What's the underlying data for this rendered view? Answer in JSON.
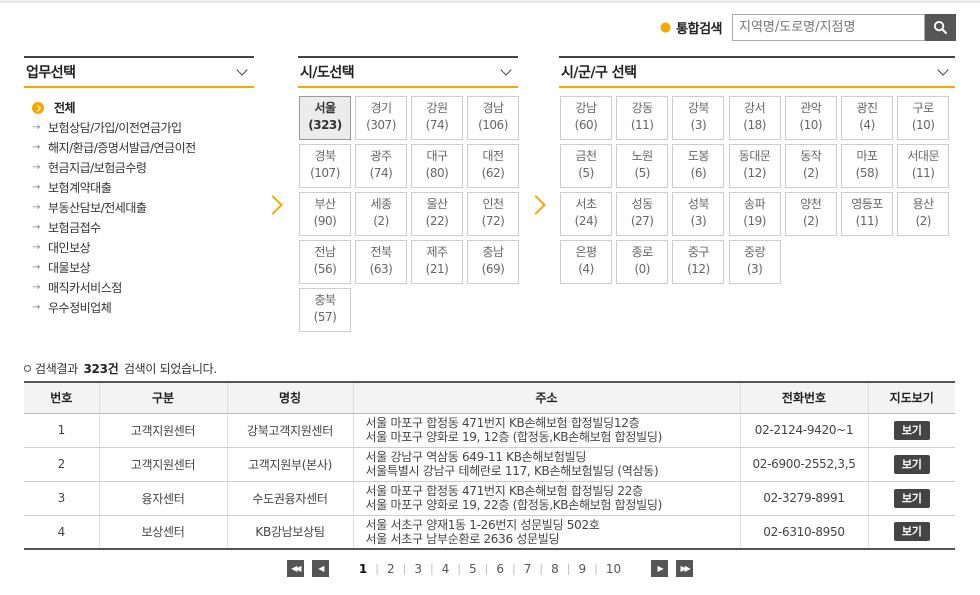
{
  "search": {
    "label": "통합검색",
    "placeholder": "지역명/도로명/지점명"
  },
  "panels": {
    "business": "업무선택",
    "sido": "시/도선택",
    "sigungu": "시/군/구 선택"
  },
  "business_items": [
    "전체",
    "보험상담/가입/이전연금가입",
    "해지/환급/증명서발급/연금이전",
    "현금지급/보험금수령",
    "보험계약대출",
    "부동산담보/전세대출",
    "보험금접수",
    "대인보상",
    "대물보상",
    "매직카서비스점",
    "우수정비업체"
  ],
  "sido": [
    {
      "name": "서울",
      "count": "(323)"
    },
    {
      "name": "경기",
      "count": "(307)"
    },
    {
      "name": "강원",
      "count": "(74)"
    },
    {
      "name": "경남",
      "count": "(106)"
    },
    {
      "name": "경북",
      "count": "(107)"
    },
    {
      "name": "광주",
      "count": "(74)"
    },
    {
      "name": "대구",
      "count": "(80)"
    },
    {
      "name": "대전",
      "count": "(62)"
    },
    {
      "name": "부산",
      "count": "(90)"
    },
    {
      "name": "세종",
      "count": "(2)"
    },
    {
      "name": "울산",
      "count": "(22)"
    },
    {
      "name": "인천",
      "count": "(72)"
    },
    {
      "name": "전남",
      "count": "(56)"
    },
    {
      "name": "전북",
      "count": "(63)"
    },
    {
      "name": "제주",
      "count": "(21)"
    },
    {
      "name": "충남",
      "count": "(69)"
    },
    {
      "name": "충북",
      "count": "(57)"
    }
  ],
  "sigungu": [
    {
      "name": "강남",
      "count": "(60)"
    },
    {
      "name": "강동",
      "count": "(11)"
    },
    {
      "name": "강북",
      "count": "(3)"
    },
    {
      "name": "강서",
      "count": "(18)"
    },
    {
      "name": "관악",
      "count": "(10)"
    },
    {
      "name": "광진",
      "count": "(4)"
    },
    {
      "name": "구로",
      "count": "(10)"
    },
    {
      "name": "금천",
      "count": "(5)"
    },
    {
      "name": "노원",
      "count": "(5)"
    },
    {
      "name": "도봉",
      "count": "(6)"
    },
    {
      "name": "동대문",
      "count": "(12)"
    },
    {
      "name": "동작",
      "count": "(2)"
    },
    {
      "name": "마포",
      "count": "(58)"
    },
    {
      "name": "서대문",
      "count": "(11)"
    },
    {
      "name": "서초",
      "count": "(24)"
    },
    {
      "name": "성동",
      "count": "(27)"
    },
    {
      "name": "성북",
      "count": "(3)"
    },
    {
      "name": "송파",
      "count": "(19)"
    },
    {
      "name": "양천",
      "count": "(2)"
    },
    {
      "name": "영등포",
      "count": "(11)"
    },
    {
      "name": "용산",
      "count": "(2)"
    },
    {
      "name": "은평",
      "count": "(4)"
    },
    {
      "name": "종로",
      "count": "(0)"
    },
    {
      "name": "중구",
      "count": "(12)"
    },
    {
      "name": "중랑",
      "count": "(3)"
    }
  ],
  "result": {
    "prefix": "검색결과",
    "count": "323건",
    "suffix": "검색이 되었습니다."
  },
  "table": {
    "headers": [
      "번호",
      "구분",
      "명칭",
      "주소",
      "전화번호",
      "지도보기"
    ],
    "rows": [
      {
        "no": "1",
        "type": "고객지원센터",
        "name": "강북고객지원센터",
        "addr1": "서울 마포구 합정동 471번지 KB손해보험 합정빌딩12층",
        "addr2": "서울 마포구 양화로 19, 12층 (합정동,KB손해보험 합정빌딩)",
        "tel": "02-2124-9420~1",
        "btn": "보기"
      },
      {
        "no": "2",
        "type": "고객지원센터",
        "name": "고객지원부(본사)",
        "addr1": "서울 강남구 역삼동 649-11 KB손해보험빌딩",
        "addr2": "서울특별시 강남구 테헤란로 117, KB손해보험빌딩 (역삼동)",
        "tel": "02-6900-2552,3,5",
        "btn": "보기"
      },
      {
        "no": "3",
        "type": "융자센터",
        "name": "수도권융자센터",
        "addr1": "서울 마포구 합정동 471번지 KB손해보험 합정빌딩 22층",
        "addr2": "서울 마포구 양화로 19, 22층 (합정동,KB손해보험 합정빌딩)",
        "tel": "02-3279-8991",
        "btn": "보기"
      },
      {
        "no": "4",
        "type": "보상센터",
        "name": "KB강남보상팀",
        "addr1": "서울 서초구 양재1동 1-26번지 성문빌딩 502호",
        "addr2": "서울 서초구 남부순환로 2636 성문빌딩",
        "tel": "02-6310-8950",
        "btn": "보기"
      }
    ]
  },
  "pagination": [
    "1",
    "2",
    "3",
    "4",
    "5",
    "6",
    "7",
    "8",
    "9",
    "10"
  ]
}
